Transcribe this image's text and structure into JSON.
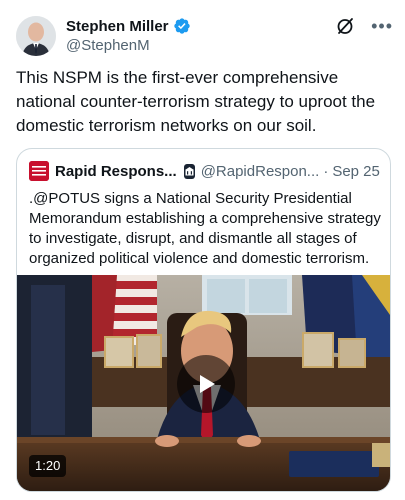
{
  "tweet": {
    "author": {
      "display_name": "Stephen Miller",
      "handle": "@StephenM",
      "verified": true
    },
    "actions": {
      "grok_icon": "grok-slash-icon",
      "more_icon": "more-options-icon",
      "more_label": "•••"
    },
    "text": "This NSPM is the first-ever comprehensive national counter-terrorism strategy to uproot the domestic terrorism networks on our soil."
  },
  "quoted": {
    "display_name": "Rapid Respons...",
    "handle": "@RapidRespon...",
    "separator": "·",
    "date": "Sep 25",
    "text": ".@POTUS signs a National Security Presidential Memorandum establishing a comprehensive strategy to investigate, disrupt, and dismantle all stages of organized political violence and domestic terrorism.",
    "video": {
      "duration": "1:20",
      "play_icon": "play-icon"
    }
  },
  "colors": {
    "text_primary": "#0f1419",
    "text_secondary": "#536471",
    "verified_blue": "#1d9bf0",
    "border": "#cfd9de"
  }
}
